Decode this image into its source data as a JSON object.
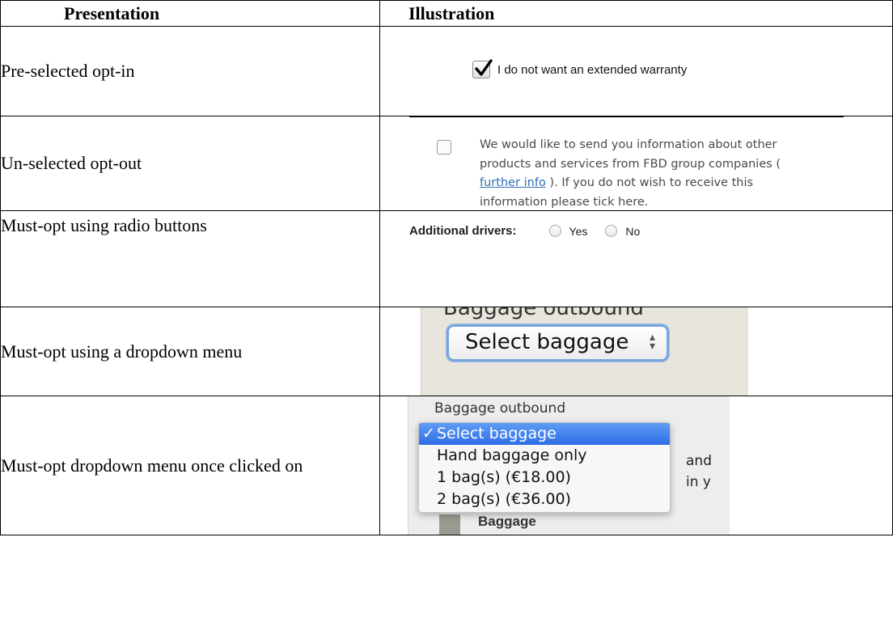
{
  "headers": {
    "presentation": "Presentation",
    "illustration": "Illustration"
  },
  "rows": [
    {
      "label": "Pre-selected opt-in",
      "checkbox_text": "I do not want an extended warranty",
      "checked": true
    },
    {
      "label": "Un-selected opt-out",
      "text_before": "We would like to send you information about other products and services from FBD group companies ( ",
      "link_text": "further info",
      "text_after": " ). If you do not wish to receive this information please tick here.",
      "checked": false
    },
    {
      "label": "Must-opt using radio buttons",
      "field_label": "Additional drivers:",
      "options": [
        "Yes",
        "No"
      ]
    },
    {
      "label": "Must-opt using a dropdown menu",
      "caption": "Baggage outbound",
      "selected_value": "Select baggage"
    },
    {
      "label": "Must-opt dropdown menu once clicked on",
      "caption": "Baggage outbound",
      "menu_items": [
        "Select baggage",
        "Hand baggage only",
        "1 bag(s) (€18.00)",
        "2 bag(s) (€36.00)"
      ],
      "selected_index": 0,
      "background_fragments": [
        "and",
        "in y",
        "Baggage"
      ]
    }
  ],
  "colors": {
    "link": "#2f6fb4",
    "menu_highlight": "#3b7bea",
    "select_focus": "#7aa6de"
  }
}
